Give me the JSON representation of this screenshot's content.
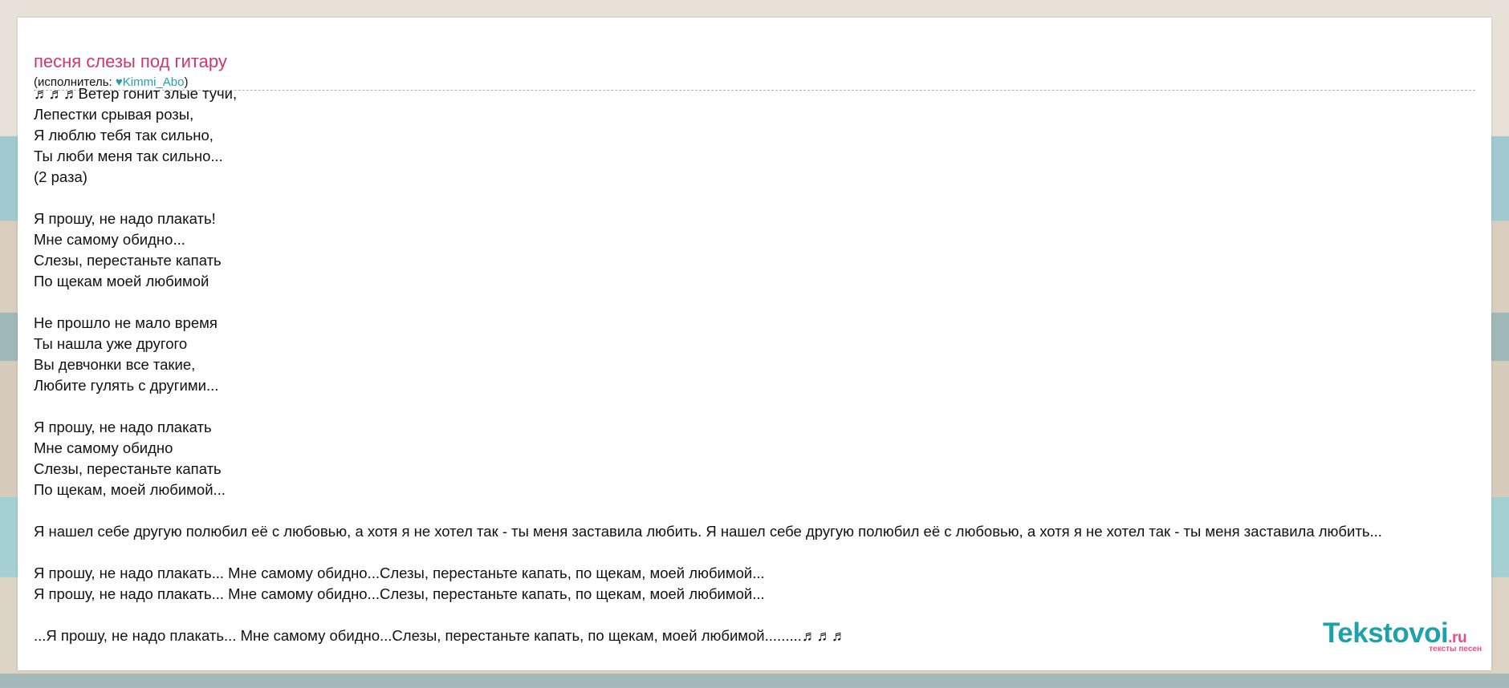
{
  "song": {
    "title": "песня слезы под гитару",
    "artist_prefix": "(исполнитель: ",
    "artist_name": "♥Kimmi_Abo",
    "artist_suffix": ")"
  },
  "lyrics": [
    "♬♬♬Ветер гонит злые тучи,",
    "Лепестки срывая розы,",
    "Я люблю тебя так сильно,",
    "Ты люби меня так сильно...",
    "(2 раза)",
    "",
    "Я прошу, не надо плакать!",
    "Мне самому обидно...",
    "Слезы, перестаньте капать",
    "По щекам моей любимой",
    "",
    "Не прошло не мало время",
    "Ты нашла уже другого",
    "Вы девчонки все такие,",
    "Любите гулять с другими...",
    "",
    "Я прошу, не надо плакать",
    "Мне самому обидно",
    "Слезы, перестаньте капать",
    "По щекам, моей любимой...",
    "",
    "Я нашел себе другую полюбил её с любовью, а хотя я не хотел так - ты меня заставила любить. Я нашел себе другую полюбил её с любовью, а хотя я не хотел так - ты меня заставила любить...",
    "",
    "Я прошу, не надо плакать... Мне самому обидно...Слезы, перестаньте капать, по щекам, моей любимой...",
    "Я прошу, не надо плакать... Мне самому обидно...Слезы, перестаньте капать, по щекам, моей любимой...",
    "",
    "...Я прошу, не надо плакать... Мне самому обидно...Слезы, перестаньте капать, по щекам, моей любимой.........♬♬♬"
  ],
  "logo": {
    "main": "Tekstovoi",
    "ru": ".ru",
    "sub": "тексты песен"
  }
}
